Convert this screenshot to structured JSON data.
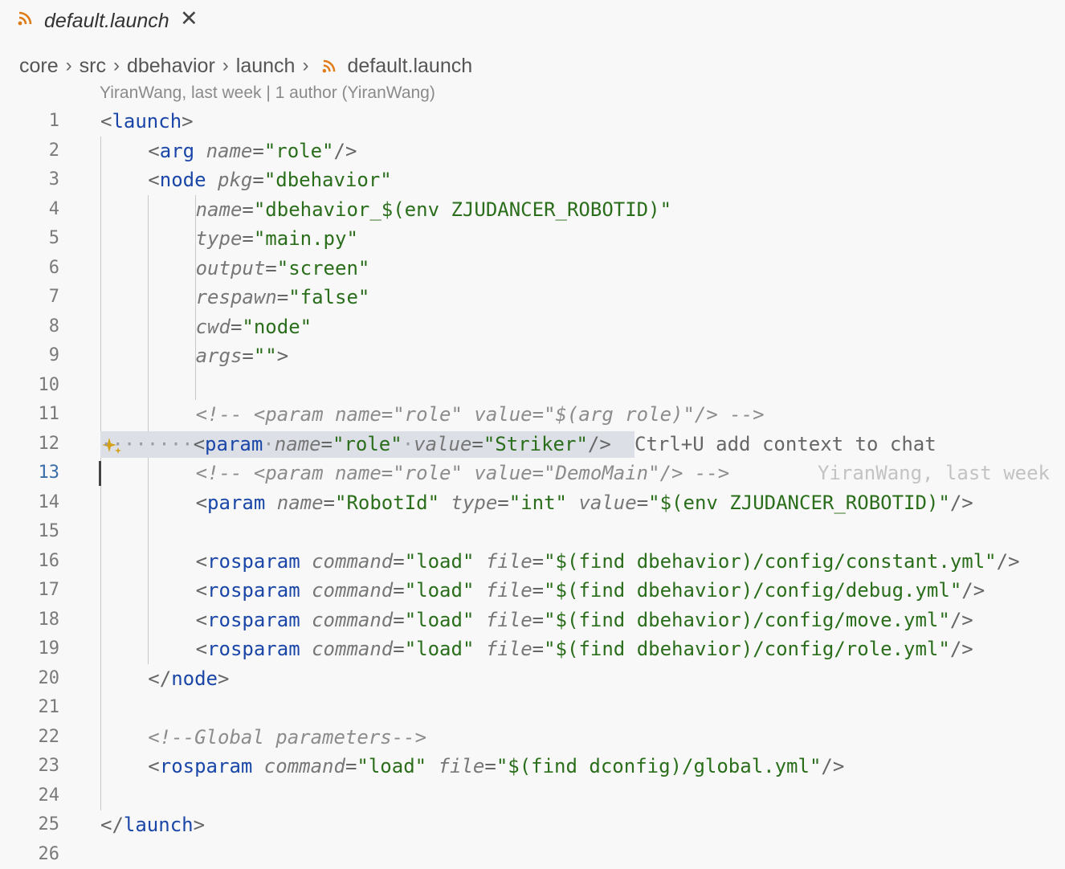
{
  "tab": {
    "title": "default.launch",
    "close_glyph": "✕",
    "icon": "rss-icon"
  },
  "breadcrumb": {
    "items": [
      "core",
      "src",
      "dbehavior",
      "launch"
    ],
    "file": "default.launch",
    "separator": "›"
  },
  "blame": "YiranWang, last week | 1 author (YiranWang)",
  "editor": {
    "active_line": 13,
    "highlight_line": 12,
    "inlay_hint": "Ctrl+U add context to chat",
    "ghost_blame": "YiranWang, last week",
    "lines": [
      {
        "n": "1",
        "ind": 0,
        "tokens": [
          [
            "p",
            "<"
          ],
          [
            "t",
            "launch"
          ],
          [
            "p",
            ">"
          ]
        ]
      },
      {
        "n": "2",
        "ind": 1,
        "tokens": [
          [
            "p",
            "<"
          ],
          [
            "t",
            "arg"
          ],
          [
            "x",
            " "
          ],
          [
            "a",
            "name"
          ],
          [
            "p",
            "="
          ],
          [
            "s",
            "\"role\""
          ],
          [
            "p",
            "/>"
          ]
        ]
      },
      {
        "n": "3",
        "ind": 1,
        "tokens": [
          [
            "p",
            "<"
          ],
          [
            "t",
            "node"
          ],
          [
            "x",
            " "
          ],
          [
            "a",
            "pkg"
          ],
          [
            "p",
            "="
          ],
          [
            "s",
            "\"dbehavior\""
          ]
        ]
      },
      {
        "n": "4",
        "ind": 2,
        "tokens": [
          [
            "a",
            "name"
          ],
          [
            "p",
            "="
          ],
          [
            "s",
            "\"dbehavior_$(env ZJUDANCER_ROBOTID)\""
          ]
        ]
      },
      {
        "n": "5",
        "ind": 2,
        "tokens": [
          [
            "a",
            "type"
          ],
          [
            "p",
            "="
          ],
          [
            "s",
            "\"main.py\""
          ]
        ]
      },
      {
        "n": "6",
        "ind": 2,
        "tokens": [
          [
            "a",
            "output"
          ],
          [
            "p",
            "="
          ],
          [
            "s",
            "\"screen\""
          ]
        ]
      },
      {
        "n": "7",
        "ind": 2,
        "tokens": [
          [
            "a",
            "respawn"
          ],
          [
            "p",
            "="
          ],
          [
            "s",
            "\"false\""
          ]
        ]
      },
      {
        "n": "8",
        "ind": 2,
        "tokens": [
          [
            "a",
            "cwd"
          ],
          [
            "p",
            "="
          ],
          [
            "s",
            "\"node\""
          ]
        ]
      },
      {
        "n": "9",
        "ind": 2,
        "tokens": [
          [
            "a",
            "args"
          ],
          [
            "p",
            "="
          ],
          [
            "s",
            "\"\""
          ],
          [
            "p",
            ">"
          ]
        ]
      },
      {
        "n": "10",
        "ind": 0,
        "tokens": []
      },
      {
        "n": "11",
        "ind": 2,
        "tokens": [
          [
            "c",
            "<!-- <param name=\"role\" value=\"$(arg role)\"/> -->"
          ]
        ]
      },
      {
        "n": "12",
        "ind": 0,
        "tokens": [
          [
            "dot",
            "········"
          ],
          [
            "p",
            "<"
          ],
          [
            "t",
            "param"
          ],
          [
            "dot",
            "·"
          ],
          [
            "a",
            "name"
          ],
          [
            "p",
            "="
          ],
          [
            "s",
            "\"role\""
          ],
          [
            "dot",
            "·"
          ],
          [
            "a",
            "value"
          ],
          [
            "p",
            "="
          ],
          [
            "s",
            "\"Striker\""
          ],
          [
            "p",
            "/>"
          ]
        ]
      },
      {
        "n": "13",
        "ind": 2,
        "tokens": [
          [
            "c",
            "<!-- <param name=\"role\" value=\"DemoMain\"/> -->"
          ]
        ]
      },
      {
        "n": "14",
        "ind": 2,
        "tokens": [
          [
            "p",
            "<"
          ],
          [
            "t",
            "param"
          ],
          [
            "x",
            " "
          ],
          [
            "a",
            "name"
          ],
          [
            "p",
            "="
          ],
          [
            "s",
            "\"RobotId\""
          ],
          [
            "x",
            " "
          ],
          [
            "a",
            "type"
          ],
          [
            "p",
            "="
          ],
          [
            "s",
            "\"int\""
          ],
          [
            "x",
            " "
          ],
          [
            "a",
            "value"
          ],
          [
            "p",
            "="
          ],
          [
            "s",
            "\"$(env ZJUDANCER_ROBOTID)\""
          ],
          [
            "p",
            "/>"
          ]
        ]
      },
      {
        "n": "15",
        "ind": 0,
        "tokens": []
      },
      {
        "n": "16",
        "ind": 2,
        "tokens": [
          [
            "p",
            "<"
          ],
          [
            "t",
            "rosparam"
          ],
          [
            "x",
            " "
          ],
          [
            "a",
            "command"
          ],
          [
            "p",
            "="
          ],
          [
            "s",
            "\"load\""
          ],
          [
            "x",
            " "
          ],
          [
            "a",
            "file"
          ],
          [
            "p",
            "="
          ],
          [
            "s",
            "\"$(find dbehavior)/config/constant.yml\""
          ],
          [
            "p",
            "/>"
          ]
        ]
      },
      {
        "n": "17",
        "ind": 2,
        "tokens": [
          [
            "p",
            "<"
          ],
          [
            "t",
            "rosparam"
          ],
          [
            "x",
            " "
          ],
          [
            "a",
            "command"
          ],
          [
            "p",
            "="
          ],
          [
            "s",
            "\"load\""
          ],
          [
            "x",
            " "
          ],
          [
            "a",
            "file"
          ],
          [
            "p",
            "="
          ],
          [
            "s",
            "\"$(find dbehavior)/config/debug.yml\""
          ],
          [
            "p",
            "/>"
          ]
        ]
      },
      {
        "n": "18",
        "ind": 2,
        "tokens": [
          [
            "p",
            "<"
          ],
          [
            "t",
            "rosparam"
          ],
          [
            "x",
            " "
          ],
          [
            "a",
            "command"
          ],
          [
            "p",
            "="
          ],
          [
            "s",
            "\"load\""
          ],
          [
            "x",
            " "
          ],
          [
            "a",
            "file"
          ],
          [
            "p",
            "="
          ],
          [
            "s",
            "\"$(find dbehavior)/config/move.yml\""
          ],
          [
            "p",
            "/>"
          ]
        ]
      },
      {
        "n": "19",
        "ind": 2,
        "tokens": [
          [
            "p",
            "<"
          ],
          [
            "t",
            "rosparam"
          ],
          [
            "x",
            " "
          ],
          [
            "a",
            "command"
          ],
          [
            "p",
            "="
          ],
          [
            "s",
            "\"load\""
          ],
          [
            "x",
            " "
          ],
          [
            "a",
            "file"
          ],
          [
            "p",
            "="
          ],
          [
            "s",
            "\"$(find dbehavior)/config/role.yml\""
          ],
          [
            "p",
            "/>"
          ]
        ]
      },
      {
        "n": "20",
        "ind": 1,
        "tokens": [
          [
            "p",
            "</"
          ],
          [
            "t",
            "node"
          ],
          [
            "p",
            ">"
          ]
        ]
      },
      {
        "n": "21",
        "ind": 0,
        "tokens": []
      },
      {
        "n": "22",
        "ind": 1,
        "tokens": [
          [
            "c",
            "<!--Global parameters-->"
          ]
        ]
      },
      {
        "n": "23",
        "ind": 1,
        "tokens": [
          [
            "p",
            "<"
          ],
          [
            "t",
            "rosparam"
          ],
          [
            "x",
            " "
          ],
          [
            "a",
            "command"
          ],
          [
            "p",
            "="
          ],
          [
            "s",
            "\"load\""
          ],
          [
            "x",
            " "
          ],
          [
            "a",
            "file"
          ],
          [
            "p",
            "="
          ],
          [
            "s",
            "\"$(find dconfig)/global.yml\""
          ],
          [
            "p",
            "/>"
          ]
        ]
      },
      {
        "n": "24",
        "ind": 0,
        "tokens": []
      },
      {
        "n": "25",
        "ind": 0,
        "tokens": [
          [
            "p",
            "</"
          ],
          [
            "t",
            "launch"
          ],
          [
            "p",
            ">"
          ]
        ]
      },
      {
        "n": "26",
        "ind": 0,
        "tokens": []
      }
    ]
  },
  "colors": {
    "tag": "#1a46a8",
    "string": "#2a6e1b",
    "attribute": "#777777",
    "comment": "#8c8c8c",
    "rss_icon": "#e07b1a",
    "sparkle": "#d4a017"
  }
}
